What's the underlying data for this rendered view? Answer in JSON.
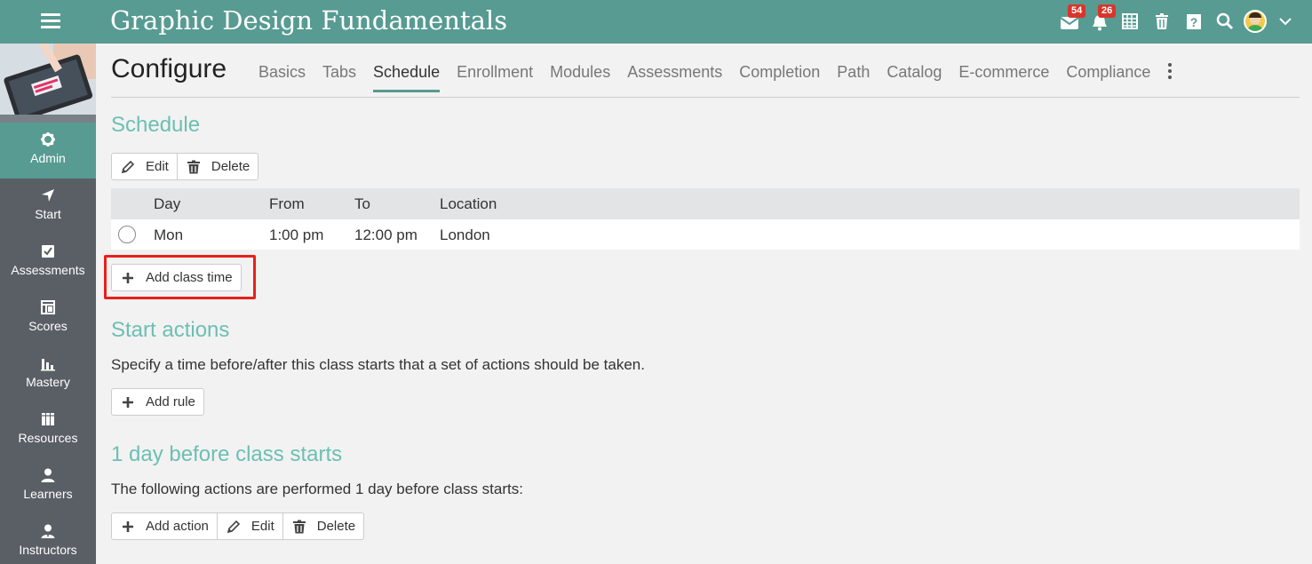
{
  "header": {
    "title": "Graphic Design Fundamentals",
    "messages_badge": "54",
    "notifications_badge": "26"
  },
  "sidebar": {
    "items": [
      {
        "label": "Admin",
        "icon": "gear-icon",
        "active": true
      },
      {
        "label": "Start",
        "icon": "location-arrow-icon"
      },
      {
        "label": "Assessments",
        "icon": "checkbox-icon"
      },
      {
        "label": "Scores",
        "icon": "gradebook-icon"
      },
      {
        "label": "Mastery",
        "icon": "bar-chart-icon"
      },
      {
        "label": "Resources",
        "icon": "books-icon"
      },
      {
        "label": "Learners",
        "icon": "person-icon"
      },
      {
        "label": "Instructors",
        "icon": "instructor-icon"
      }
    ]
  },
  "page": {
    "heading": "Configure",
    "tabs": [
      "Basics",
      "Tabs",
      "Schedule",
      "Enrollment",
      "Modules",
      "Assessments",
      "Completion",
      "Path",
      "Catalog",
      "E-commerce",
      "Compliance"
    ],
    "active_tab": "Schedule"
  },
  "schedule": {
    "title": "Schedule",
    "edit_label": "Edit",
    "delete_label": "Delete",
    "columns": [
      "Day",
      "From",
      "To",
      "Location"
    ],
    "rows": [
      {
        "day": "Mon",
        "from": "1:00 pm",
        "to": "12:00 pm",
        "location": "London"
      }
    ],
    "add_class_time_label": "Add class time"
  },
  "start_actions": {
    "title": "Start actions",
    "description": "Specify a time before/after this class starts that a set of actions should be taken.",
    "add_rule_label": "Add rule"
  },
  "rule": {
    "title": "1 day before class starts",
    "description": "The following actions are performed 1 day before class starts:",
    "add_action_label": "Add action",
    "edit_label": "Edit",
    "delete_label": "Delete"
  },
  "colors": {
    "brand": "#579b92",
    "accent_heading": "#6cbfb3",
    "badge": "#d9352b",
    "highlight": "#e8201a",
    "sidebar": "#5a5f66"
  }
}
